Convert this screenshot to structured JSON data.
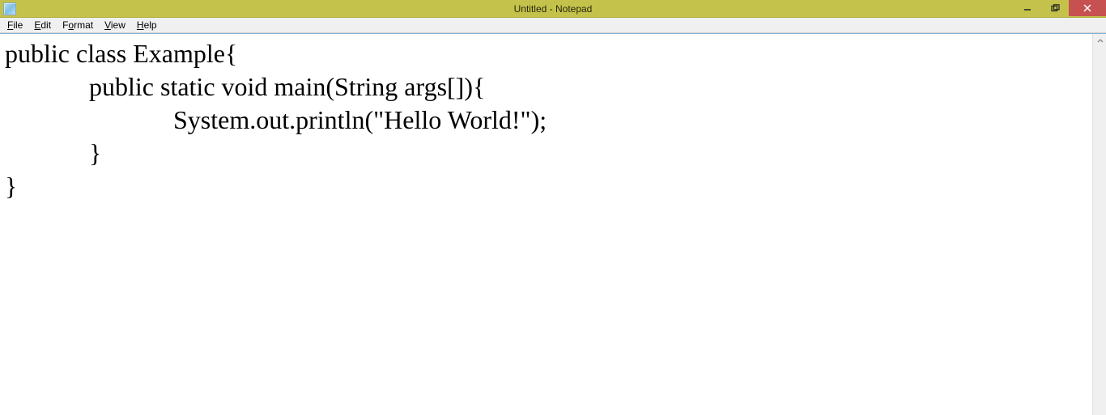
{
  "window": {
    "title": "Untitled - Notepad"
  },
  "menu": {
    "items": [
      {
        "underlined": "F",
        "rest": "ile"
      },
      {
        "underlined": "E",
        "rest": "dit"
      },
      {
        "underlined": "F",
        "prefix": "",
        "rest": "ormat",
        "u": "F"
      },
      {
        "underlined": "V",
        "rest": "iew"
      },
      {
        "underlined": "H",
        "rest": "elp"
      }
    ],
    "file": {
      "u": "F",
      "rest": "ile"
    },
    "edit": {
      "u": "E",
      "rest": "dit"
    },
    "format": {
      "u": "o",
      "pre": "F",
      "post": "rmat"
    },
    "view": {
      "u": "V",
      "rest": "iew"
    },
    "help": {
      "u": "H",
      "rest": "elp"
    }
  },
  "content": {
    "text": "public class Example{\n             public static void main(String args[]){\n                          System.out.println(\"Hello World!\");\n             }\n}"
  }
}
